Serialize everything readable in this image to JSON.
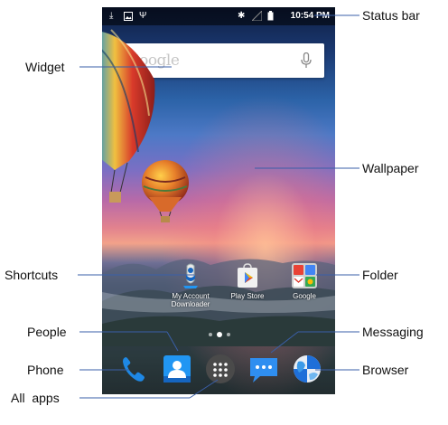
{
  "status_bar": {
    "time": "10:54 PM",
    "left_icons": [
      "download-icon",
      "image-icon",
      "usb-icon"
    ],
    "right_icons": [
      "bluetooth-icon",
      "signal-icon",
      "battery-icon"
    ]
  },
  "search_widget": {
    "placeholder": "Google",
    "mic_icon": "mic-icon"
  },
  "shortcuts": [
    {
      "label": "My Account Downloader",
      "label_line1": "My Account",
      "label_line2": "Downloader",
      "icon": "account-downloader-icon"
    },
    {
      "label": "Play Store",
      "icon": "play-store-icon"
    },
    {
      "label": "Google",
      "icon": "google-folder-icon"
    }
  ],
  "dock": [
    {
      "name": "Phone",
      "icon": "phone-icon"
    },
    {
      "name": "People",
      "icon": "people-icon"
    },
    {
      "name": "All apps",
      "icon": "all-apps-icon"
    },
    {
      "name": "Messaging",
      "icon": "messaging-icon"
    },
    {
      "name": "Browser",
      "icon": "browser-icon"
    }
  ],
  "callouts": {
    "status_bar": "Status bar",
    "widget": "Widget",
    "wallpaper": "Wallpaper",
    "shortcuts": "Shortcuts",
    "folder": "Folder",
    "people": "People",
    "messaging": "Messaging",
    "phone": "Phone",
    "browser": "Browser",
    "all_apps": "All  apps"
  },
  "colors": {
    "phone_blue": "#1e88e5",
    "people_blue": "#2196f3",
    "messaging_blue": "#2f8ef0",
    "all_apps_gray": "#4a4a4a"
  }
}
